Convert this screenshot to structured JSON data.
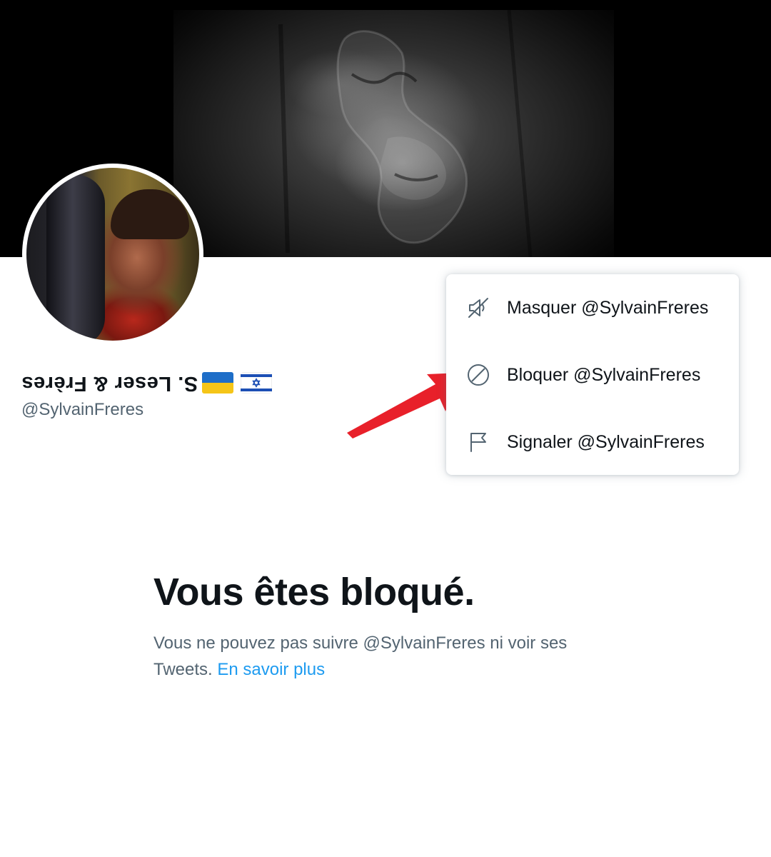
{
  "profile": {
    "display_name": "S. Leser & Frères",
    "handle": "@SylvainFreres",
    "flags": [
      "ukraine-flag",
      "israel-flag"
    ]
  },
  "menu": {
    "items": [
      {
        "label": "Masquer @SylvainFreres",
        "icon": "mute-speaker-icon"
      },
      {
        "label": "Bloquer @SylvainFreres",
        "icon": "block-icon"
      },
      {
        "label": "Signaler @SylvainFreres",
        "icon": "flag-icon"
      }
    ]
  },
  "blocked": {
    "title": "Vous êtes bloqué.",
    "description": "Vous ne pouvez pas suivre @SylvainFreres ni voir ses Tweets.",
    "learn_more": "En savoir plus"
  },
  "colors": {
    "text_primary": "#0f1419",
    "text_secondary": "#536471",
    "link": "#1d9bf0",
    "annotation_arrow": "#e8202a"
  }
}
